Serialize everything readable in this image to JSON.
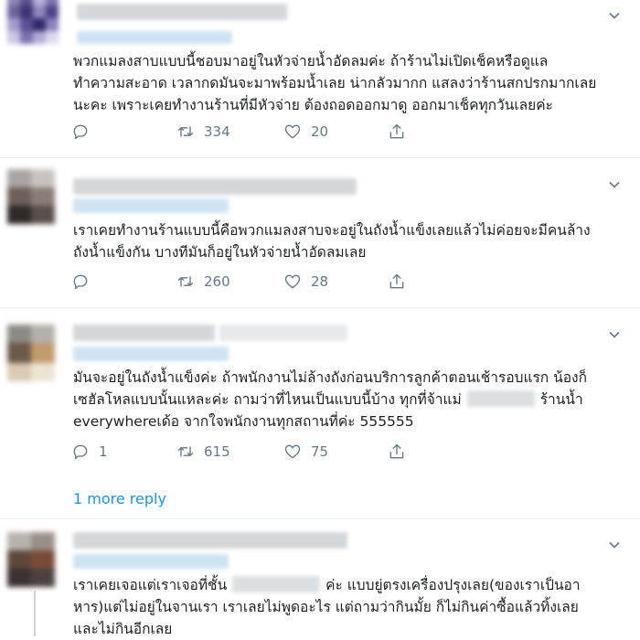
{
  "tweets": [
    {
      "lines": [
        "พวกแมลงสาบแบบนี้ชอบมาอยู่ในหัวจ่ายน้ำอัดลมค่ะ ถ้าร้านไม่เปิดเช็คหรือดูแล",
        "ทำความสะอาด เวลากดมันจะมาพร้อมน้ำเลย น่ากลัวมากก แสลงว่าร้านสกปรกมากเลย",
        "นะคะ เพราะเคยทำงานร้านที่มีหัวจ่าย ต้องถอดออกมาดู ออกมาเช็คทุกวันเลยค่ะ"
      ],
      "replies": "",
      "retweets": "334",
      "likes": "20"
    },
    {
      "lines": [
        "เราเคยทำงานร้านแบบนี้คือพวกแมลงสาบจะอยู่ในถังน้ำแข็งเลยแล้วไม่ค่อยจะมีคนล้าง",
        "ถังน้ำแข็งกัน บางทีมันก็อยู่ในหัวจ่ายน้ำอัดลมเลย"
      ],
      "replies": "",
      "retweets": "260",
      "likes": "28"
    },
    {
      "line1": "มันจะอยู่ในถังน้ำแข็งค่ะ ถ้าพนักงานไม่ล้างถังก่อนบริการลูกค้าตอนเช้ารอบแรก น้องก็",
      "line2_a": "เซฮัลโหลแบบนั้นแหละค่ะ ถามว่าที่ไหนเป็นแบบนี้บ้าง ทุกที่จ้าแม่",
      "line2_b": "ร้านน้ำ",
      "line3": "everywhereเด้อ จากใจพนักงานทุกสถานที่ค่ะ 555555",
      "replies": "1",
      "retweets": "615",
      "likes": "75"
    },
    {
      "line1_a": "เราเคยเจอแต่เราเจอที่ชั้น",
      "line1_b": "ค่ะ แบบยู่ตรงเครื่องปรุงเลย(ของเราเป็นอา",
      "line2": "หาร)แต่ไม่อยู่ในจานเรา เราเลยไม่พูดอะไร แต่ถามว่ากินมั้ย ก็ไม่กินค่าซื้อแล้วทิ้งเลย",
      "line3": "และไม่กินอีกเลย"
    }
  ],
  "more_reply": "1 more reply",
  "colors": {
    "link": "#1b95e0",
    "muted": "#657786",
    "separator": "#e6ecf0"
  },
  "icons": [
    "reply-icon",
    "retweet-icon",
    "like-icon",
    "share-icon",
    "chevron-down-icon"
  ]
}
